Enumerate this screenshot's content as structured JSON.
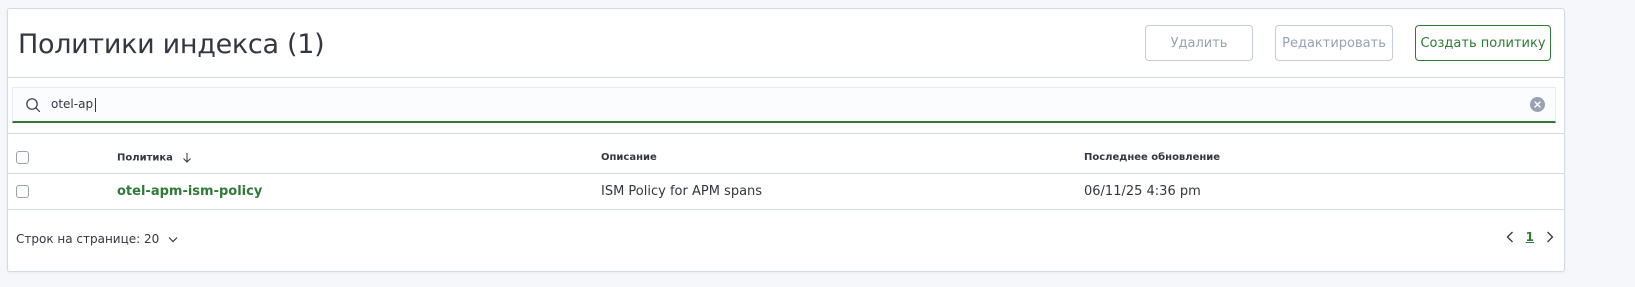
{
  "header": {
    "title": "Политики индекса (1)",
    "delete_label": "Удалить",
    "edit_label": "Редактировать",
    "create_label": "Создать политику"
  },
  "search": {
    "value": "otel-ap"
  },
  "table": {
    "columns": [
      "Политика",
      "Описание",
      "Последнее обновление"
    ],
    "rows": [
      {
        "policy": "otel-apm-ism-policy",
        "description": "ISM Policy for APM spans",
        "updated": "06/11/25 4:36 pm"
      }
    ]
  },
  "footer": {
    "rows_per_page_label": "Строк на странице: 20",
    "current_page": "1"
  },
  "colors": {
    "accent": "#2f7a35",
    "border": "#d3dae6",
    "text": "#343741",
    "disabled": "#98a2b3"
  },
  "icons": {
    "search": "search-icon",
    "clear": "clear-icon",
    "sort": "arrow-down-icon",
    "rows_dropdown": "chevron-down-icon",
    "prev_page": "chevron-left-icon",
    "next_page": "chevron-right-icon"
  }
}
